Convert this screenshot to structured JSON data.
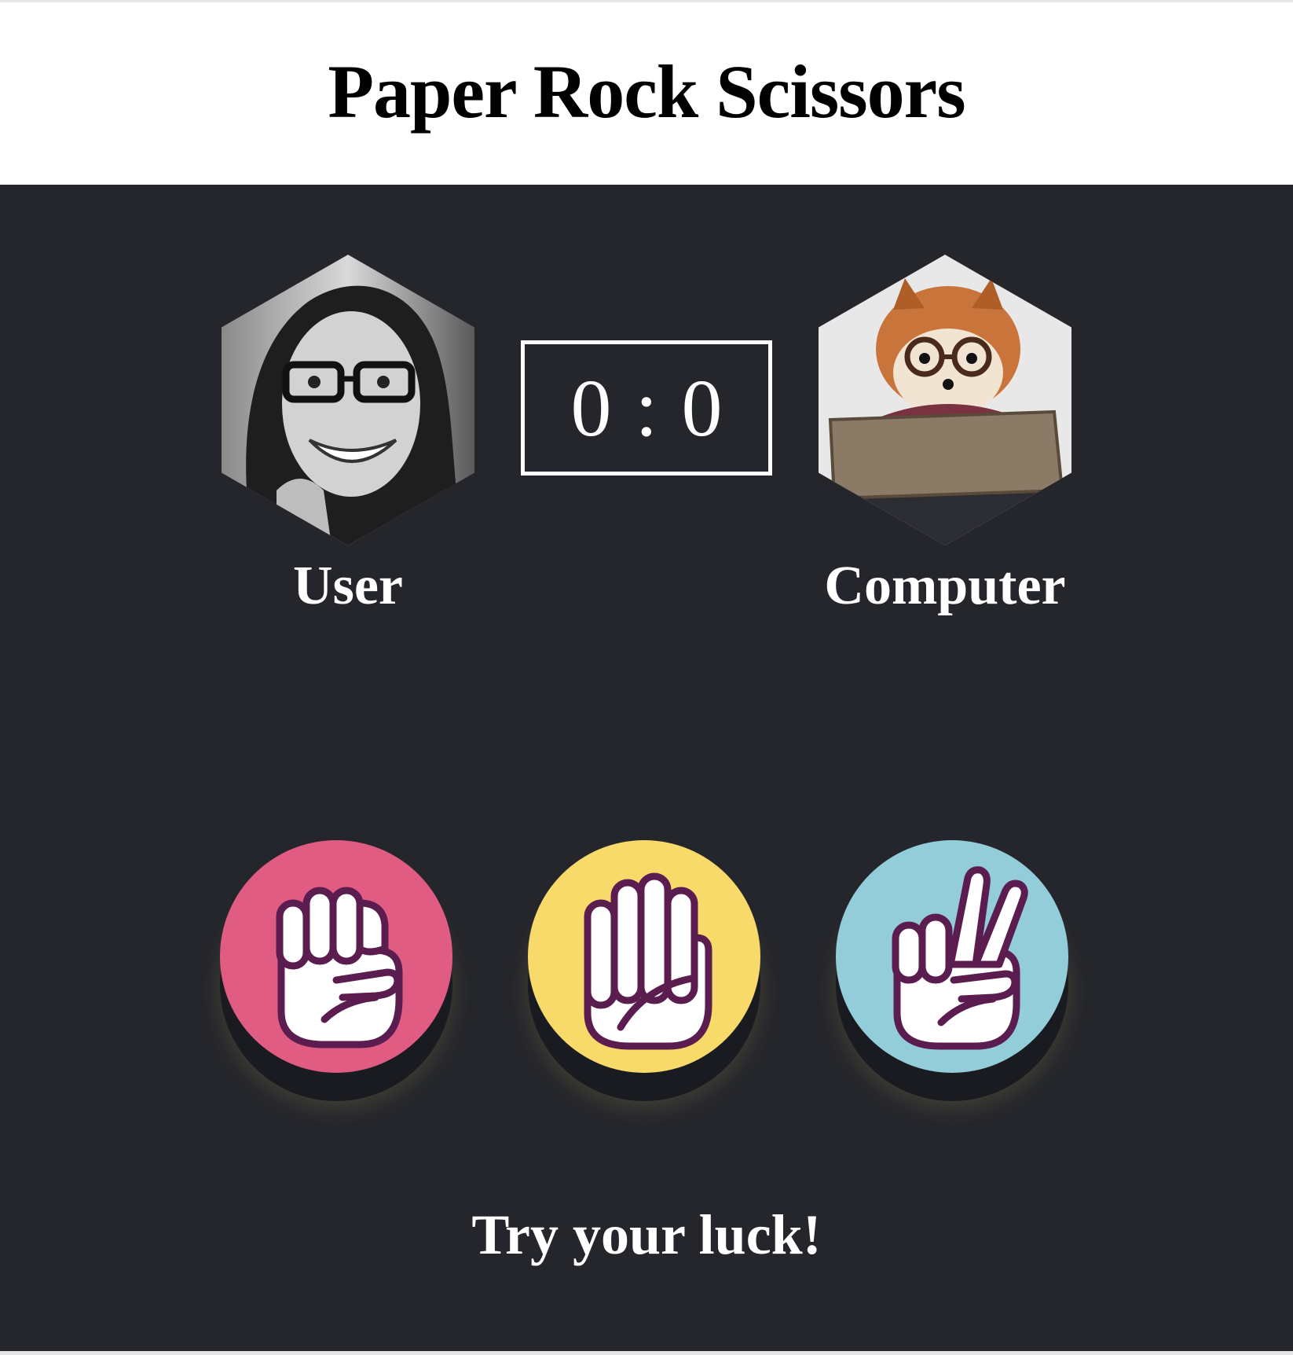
{
  "header": {
    "title": "Paper Rock Scissors"
  },
  "players": {
    "user": {
      "label": "User",
      "avatar": "user-avatar"
    },
    "computer": {
      "label": "Computer",
      "avatar": "computer-avatar"
    }
  },
  "score": {
    "user": "0",
    "separator": ":",
    "computer": "0"
  },
  "choices": [
    {
      "name": "rock",
      "icon": "rock-hand-icon",
      "color": "#e05c83"
    },
    {
      "name": "paper",
      "icon": "paper-hand-icon",
      "color": "#f8da6b"
    },
    {
      "name": "scissors",
      "icon": "scissors-hand-icon",
      "color": "#92cdd9"
    }
  ],
  "message": "Try your luck!",
  "colors": {
    "board": "#25262c",
    "hand_outline": "#5b1c4f"
  }
}
